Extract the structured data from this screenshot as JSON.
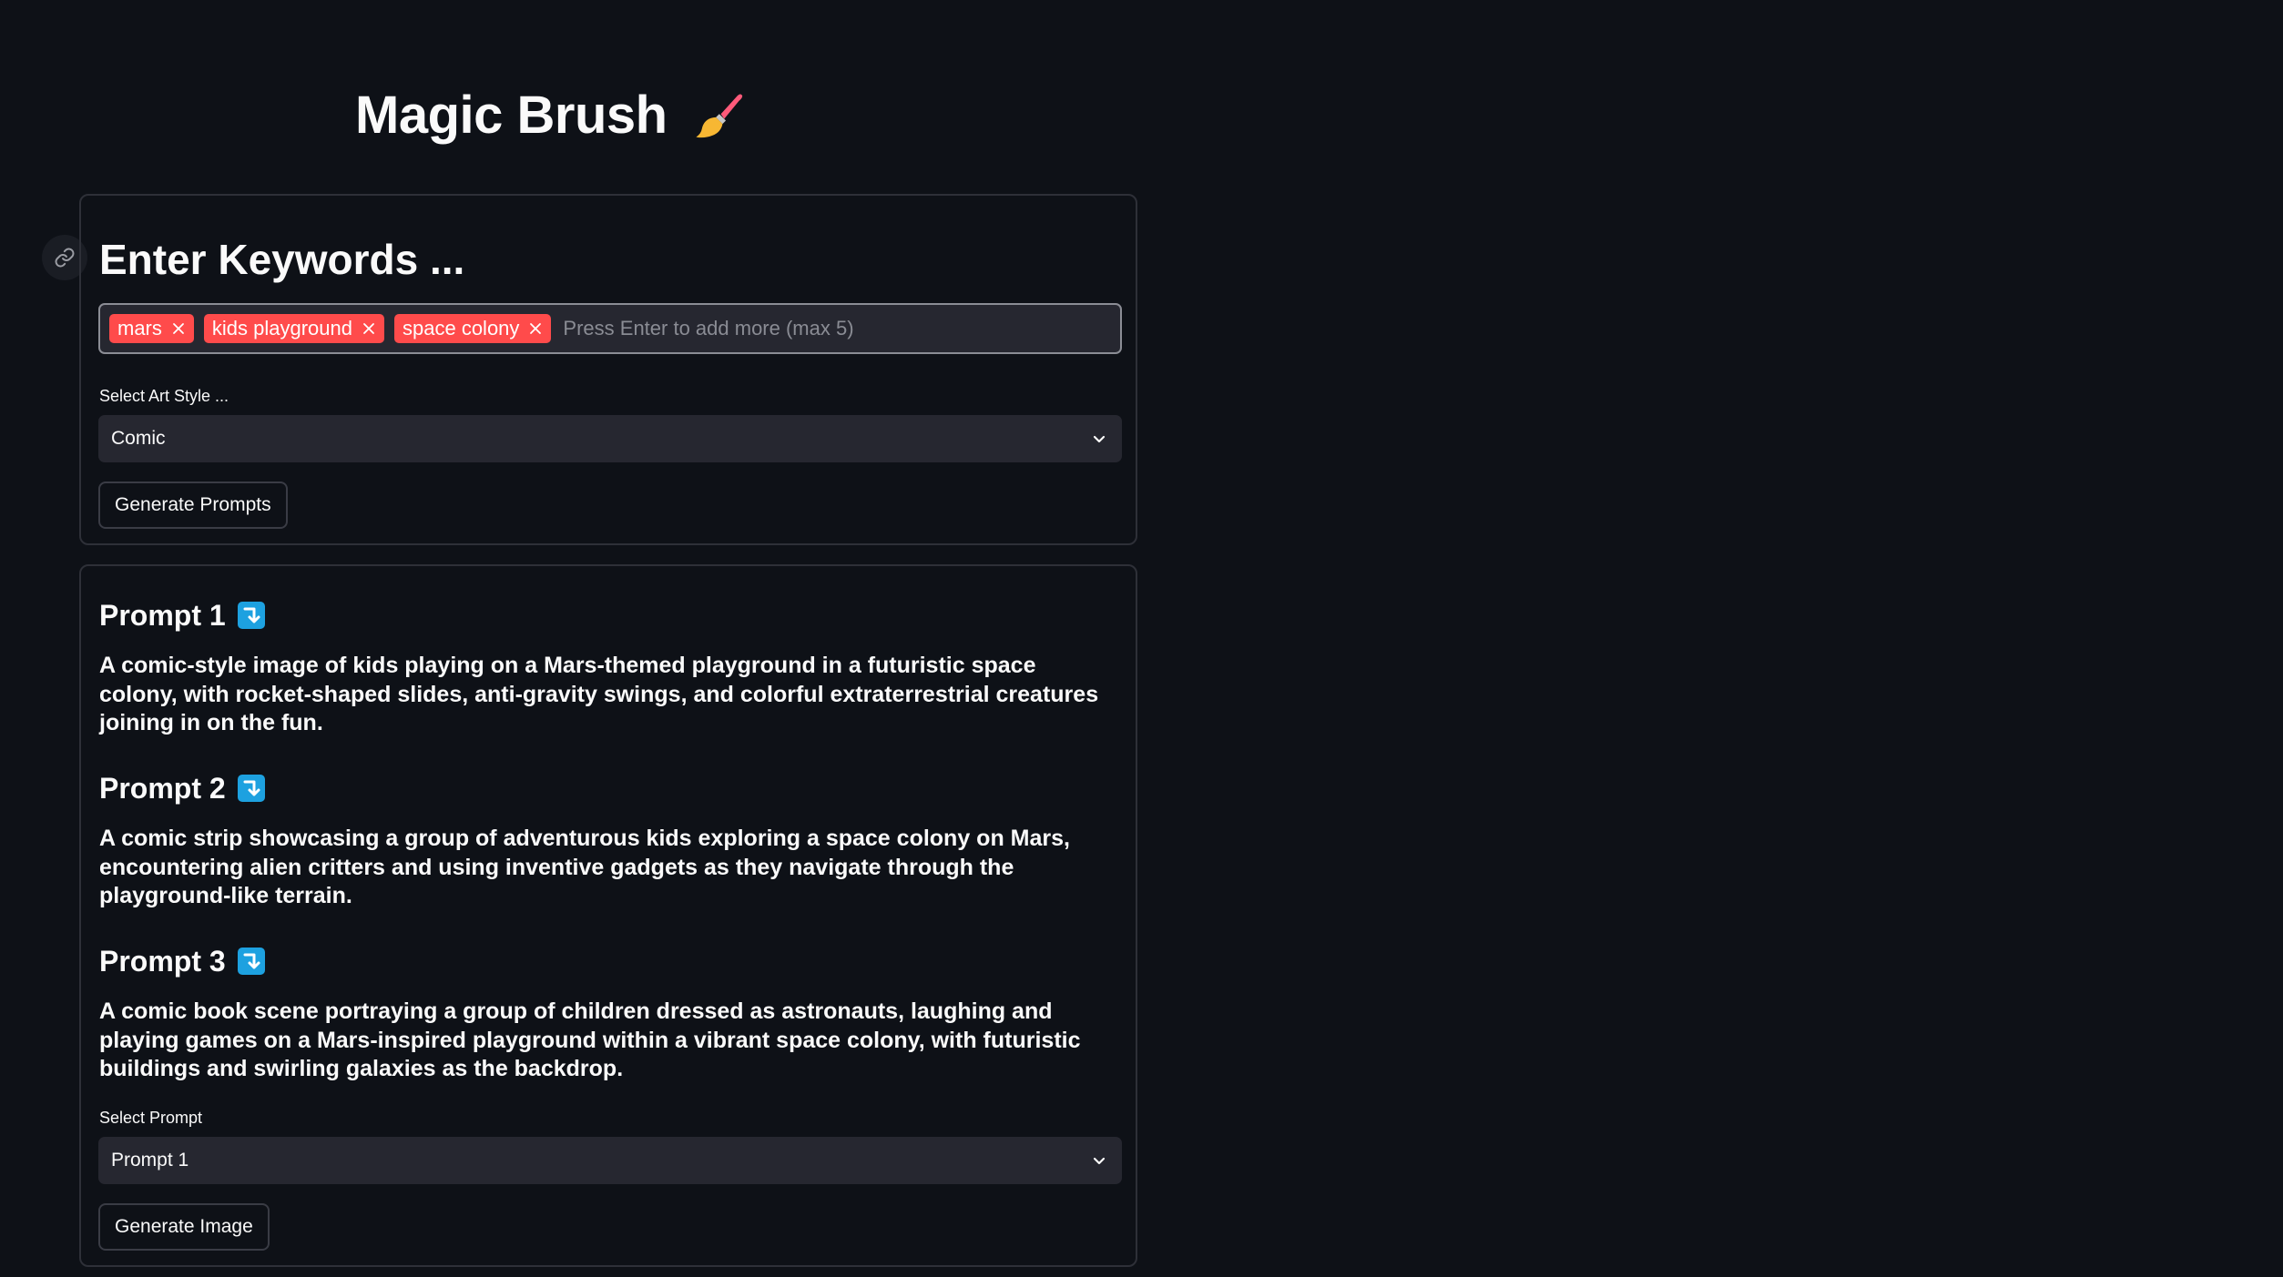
{
  "app": {
    "title": "Magic Brush",
    "title_icon": "paintbrush-icon"
  },
  "keywords_section": {
    "heading": "Enter Keywords ...",
    "tags": [
      {
        "label": "mars"
      },
      {
        "label": "kids playground"
      },
      {
        "label": "space colony"
      }
    ],
    "input_placeholder": "Press Enter to add more (max 5)",
    "art_style_label": "Select Art Style ...",
    "art_style_value": "Comic",
    "generate_prompts_label": "Generate Prompts"
  },
  "prompts_section": {
    "prompts": [
      {
        "title": "Prompt 1",
        "text": "A comic-style image of kids playing on a Mars-themed playground in a futuristic space colony, with rocket-shaped slides, anti-gravity swings, and colorful extraterrestrial creatures joining in on the fun."
      },
      {
        "title": "Prompt 2",
        "text": "A comic strip showcasing a group of adventurous kids exploring a space colony on Mars, encountering alien critters and using inventive gadgets as they navigate through the playground-like terrain."
      },
      {
        "title": "Prompt 3",
        "text": "A comic book scene portraying a group of children dressed as astronauts, laughing and playing games on a Mars-inspired playground within a vibrant space colony, with futuristic buildings and swirling galaxies as the backdrop."
      }
    ],
    "select_prompt_label": "Select Prompt",
    "select_prompt_value": "Prompt 1",
    "generate_image_label": "Generate Image"
  },
  "colors": {
    "background": "#0e1117",
    "tag": "#ff4b4b",
    "input_bg": "#262730",
    "arrow_icon_bg": "#1da1e0"
  }
}
